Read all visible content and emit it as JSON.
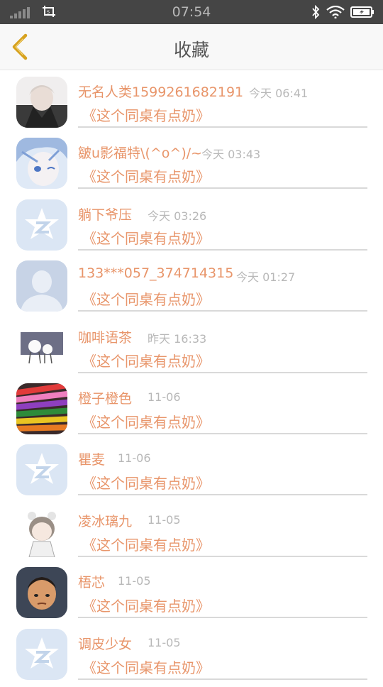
{
  "status_bar": {
    "time": "07:54"
  },
  "header": {
    "title": "收藏"
  },
  "colors": {
    "accent": "#e8956a",
    "timestamp": "#b8b8b8",
    "back_arrow": "#d7a21f"
  },
  "items": [
    {
      "name": "无名人类1599261682191",
      "time": "今天 06:41",
      "book": "《这个同桌有点奶》",
      "avatar": "anime-portrait-avatar"
    },
    {
      "name": "皺u影福特\\(^o^)/~",
      "time": "今天 03:43",
      "book": "《这个同桌有点奶》",
      "avatar": "anime-blue-hair-avatar"
    },
    {
      "name": "躺下爷压",
      "time": "今天 03:26",
      "book": "《这个同桌有点奶》",
      "avatar": "default-qq-avatar"
    },
    {
      "name": "133***057_374714315",
      "time": "今天 01:27",
      "book": "《这个同桌有点奶》",
      "avatar": "default-person-avatar"
    },
    {
      "name": "咖啡语茶",
      "time": "昨天 16:33",
      "book": "《这个同桌有点奶》",
      "avatar": "cartoon-figures-avatar"
    },
    {
      "name": "橙子橙色",
      "time": "11-06",
      "book": "《这个同桌有点奶》",
      "avatar": "colored-pencils-avatar"
    },
    {
      "name": "瞿麦",
      "time": "11-06",
      "book": "《这个同桌有点奶》",
      "avatar": "default-qq-avatar"
    },
    {
      "name": "凌冰璃九",
      "time": "11-05",
      "book": "《这个同桌有点奶》",
      "avatar": "anime-chibi-avatar"
    },
    {
      "name": "梧芯",
      "time": "11-05",
      "book": "《这个同桌有点奶》",
      "avatar": "cartoon-boy-avatar"
    },
    {
      "name": "调皮少女",
      "time": "11-05",
      "book": "《这个同桌有点奶》",
      "avatar": "default-qq-avatar"
    }
  ]
}
